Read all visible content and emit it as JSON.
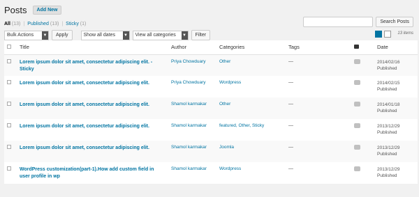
{
  "header": {
    "title": "Posts",
    "add_new": "Add New"
  },
  "filters": {
    "all": "All",
    "all_count": "(13)",
    "published": "Published",
    "published_count": "(13)",
    "sticky": "Sticky",
    "sticky_count": "(1)"
  },
  "search": {
    "button": "Search Posts",
    "placeholder": ""
  },
  "tablenav": {
    "bulk_actions": "Bulk Actions",
    "apply": "Apply",
    "dates": "Show all dates",
    "categories": "View all categories",
    "filter": "Filter",
    "items": "13 items"
  },
  "columns": {
    "title": "Title",
    "author": "Author",
    "categories": "Categories",
    "tags": "Tags",
    "date": "Date"
  },
  "posts": [
    {
      "title": "Lorem ipsum dolor sit amet, consectetur adipiscing elit. - Sticky",
      "author": "Priya Chowduary",
      "categories": "Other",
      "tags": "—",
      "comments": "0",
      "date": "2014/02/16",
      "status": "Published"
    },
    {
      "title": "Lorem ipsum dolor sit amet, consectetur adipiscing elit.",
      "author": "Priya Chowduary",
      "categories": "Wordpress",
      "tags": "—",
      "comments": "0",
      "date": "2014/02/15",
      "status": "Published"
    },
    {
      "title": "Lorem ipsum dolor sit amet, consectetur adipiscing elit.",
      "author": "Shamol karmakar",
      "categories": "Other",
      "tags": "—",
      "comments": "0",
      "date": "2014/01/18",
      "status": "Published"
    },
    {
      "title": "Lorem ipsum dolor sit amet, consectetur adipiscing elit.",
      "author": "Shamol karmakar",
      "categories": "featured, Other, Sticky",
      "tags": "—",
      "comments": "0",
      "date": "2013/12/29",
      "status": "Published"
    },
    {
      "title": "Lorem ipsum dolor sit amet, consectetur adipiscing elit.",
      "author": "Shamol karmakar",
      "categories": "Joomla",
      "tags": "—",
      "comments": "0",
      "date": "2013/12/29",
      "status": "Published"
    },
    {
      "title": "WordPress customization(part-1).How add custom field in user profile in wp",
      "author": "Shamol karmakar",
      "categories": "Wordpress",
      "tags": "—",
      "comments": "0",
      "date": "2013/12/29",
      "status": "Published"
    }
  ]
}
